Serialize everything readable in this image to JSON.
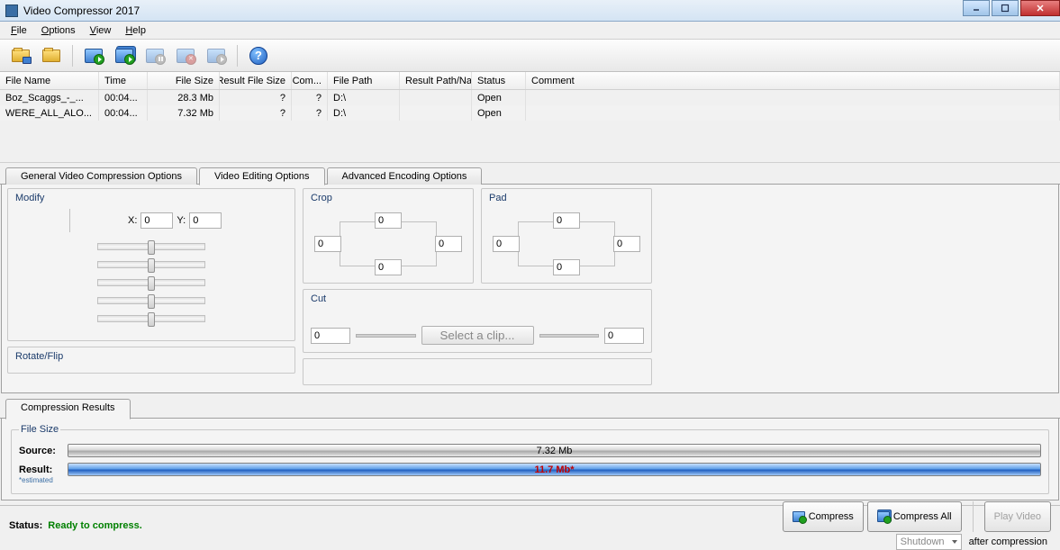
{
  "window": {
    "title": "Video Compressor 2017"
  },
  "menu": {
    "file": "File",
    "options": "Options",
    "view": "View",
    "help": "Help"
  },
  "columns": {
    "name": "File Name",
    "time": "Time",
    "fsize": "File Size",
    "rfsize": "Result File Size",
    "comp": "Com...",
    "path": "File Path",
    "rpath": "Result Path/Na...",
    "status": "Status",
    "comment": "Comment"
  },
  "rows": [
    {
      "name": "Boz_Scaggs_-_...",
      "time": "00:04...",
      "fsize": "28.3 Mb",
      "rfsize": "?",
      "comp": "?",
      "path": "D:\\",
      "rpath": "",
      "status": "Open",
      "comment": ""
    },
    {
      "name": "WERE_ALL_ALO...",
      "time": "00:04...",
      "fsize": "7.32 Mb",
      "rfsize": "?",
      "comp": "?",
      "path": "D:\\",
      "rpath": "",
      "status": "Open",
      "comment": ""
    }
  ],
  "tabs": {
    "general": "General Video Compression Options",
    "editing": "Video Editing Options",
    "advanced": "Advanced Encoding Options"
  },
  "edit": {
    "modify": "Modify",
    "x": "X:",
    "y": "Y:",
    "xval": "0",
    "yval": "0",
    "crop": "Crop",
    "pad": "Pad",
    "cut": "Cut",
    "cut_from": "0",
    "cut_to": "0",
    "clip_btn": "Select a clip...",
    "crop_t": "0",
    "crop_l": "0",
    "crop_r": "0",
    "crop_b": "0",
    "pad_t": "0",
    "pad_l": "0",
    "pad_r": "0",
    "pad_b": "0",
    "rotate": "Rotate/Flip"
  },
  "results": {
    "tab": "Compression Results",
    "filesize": "File Size",
    "source_lbl": "Source:",
    "source_val": "7.32 Mb",
    "result_lbl": "Result:",
    "result_val": "11.7 Mb*",
    "estimated": "*estimated"
  },
  "footer": {
    "status_lbl": "Status:",
    "status_val": "Ready to compress.",
    "compress": "Compress",
    "compress_all": "Compress All",
    "play": "Play Video",
    "shutdown": "Shutdown",
    "after": "after compression"
  }
}
